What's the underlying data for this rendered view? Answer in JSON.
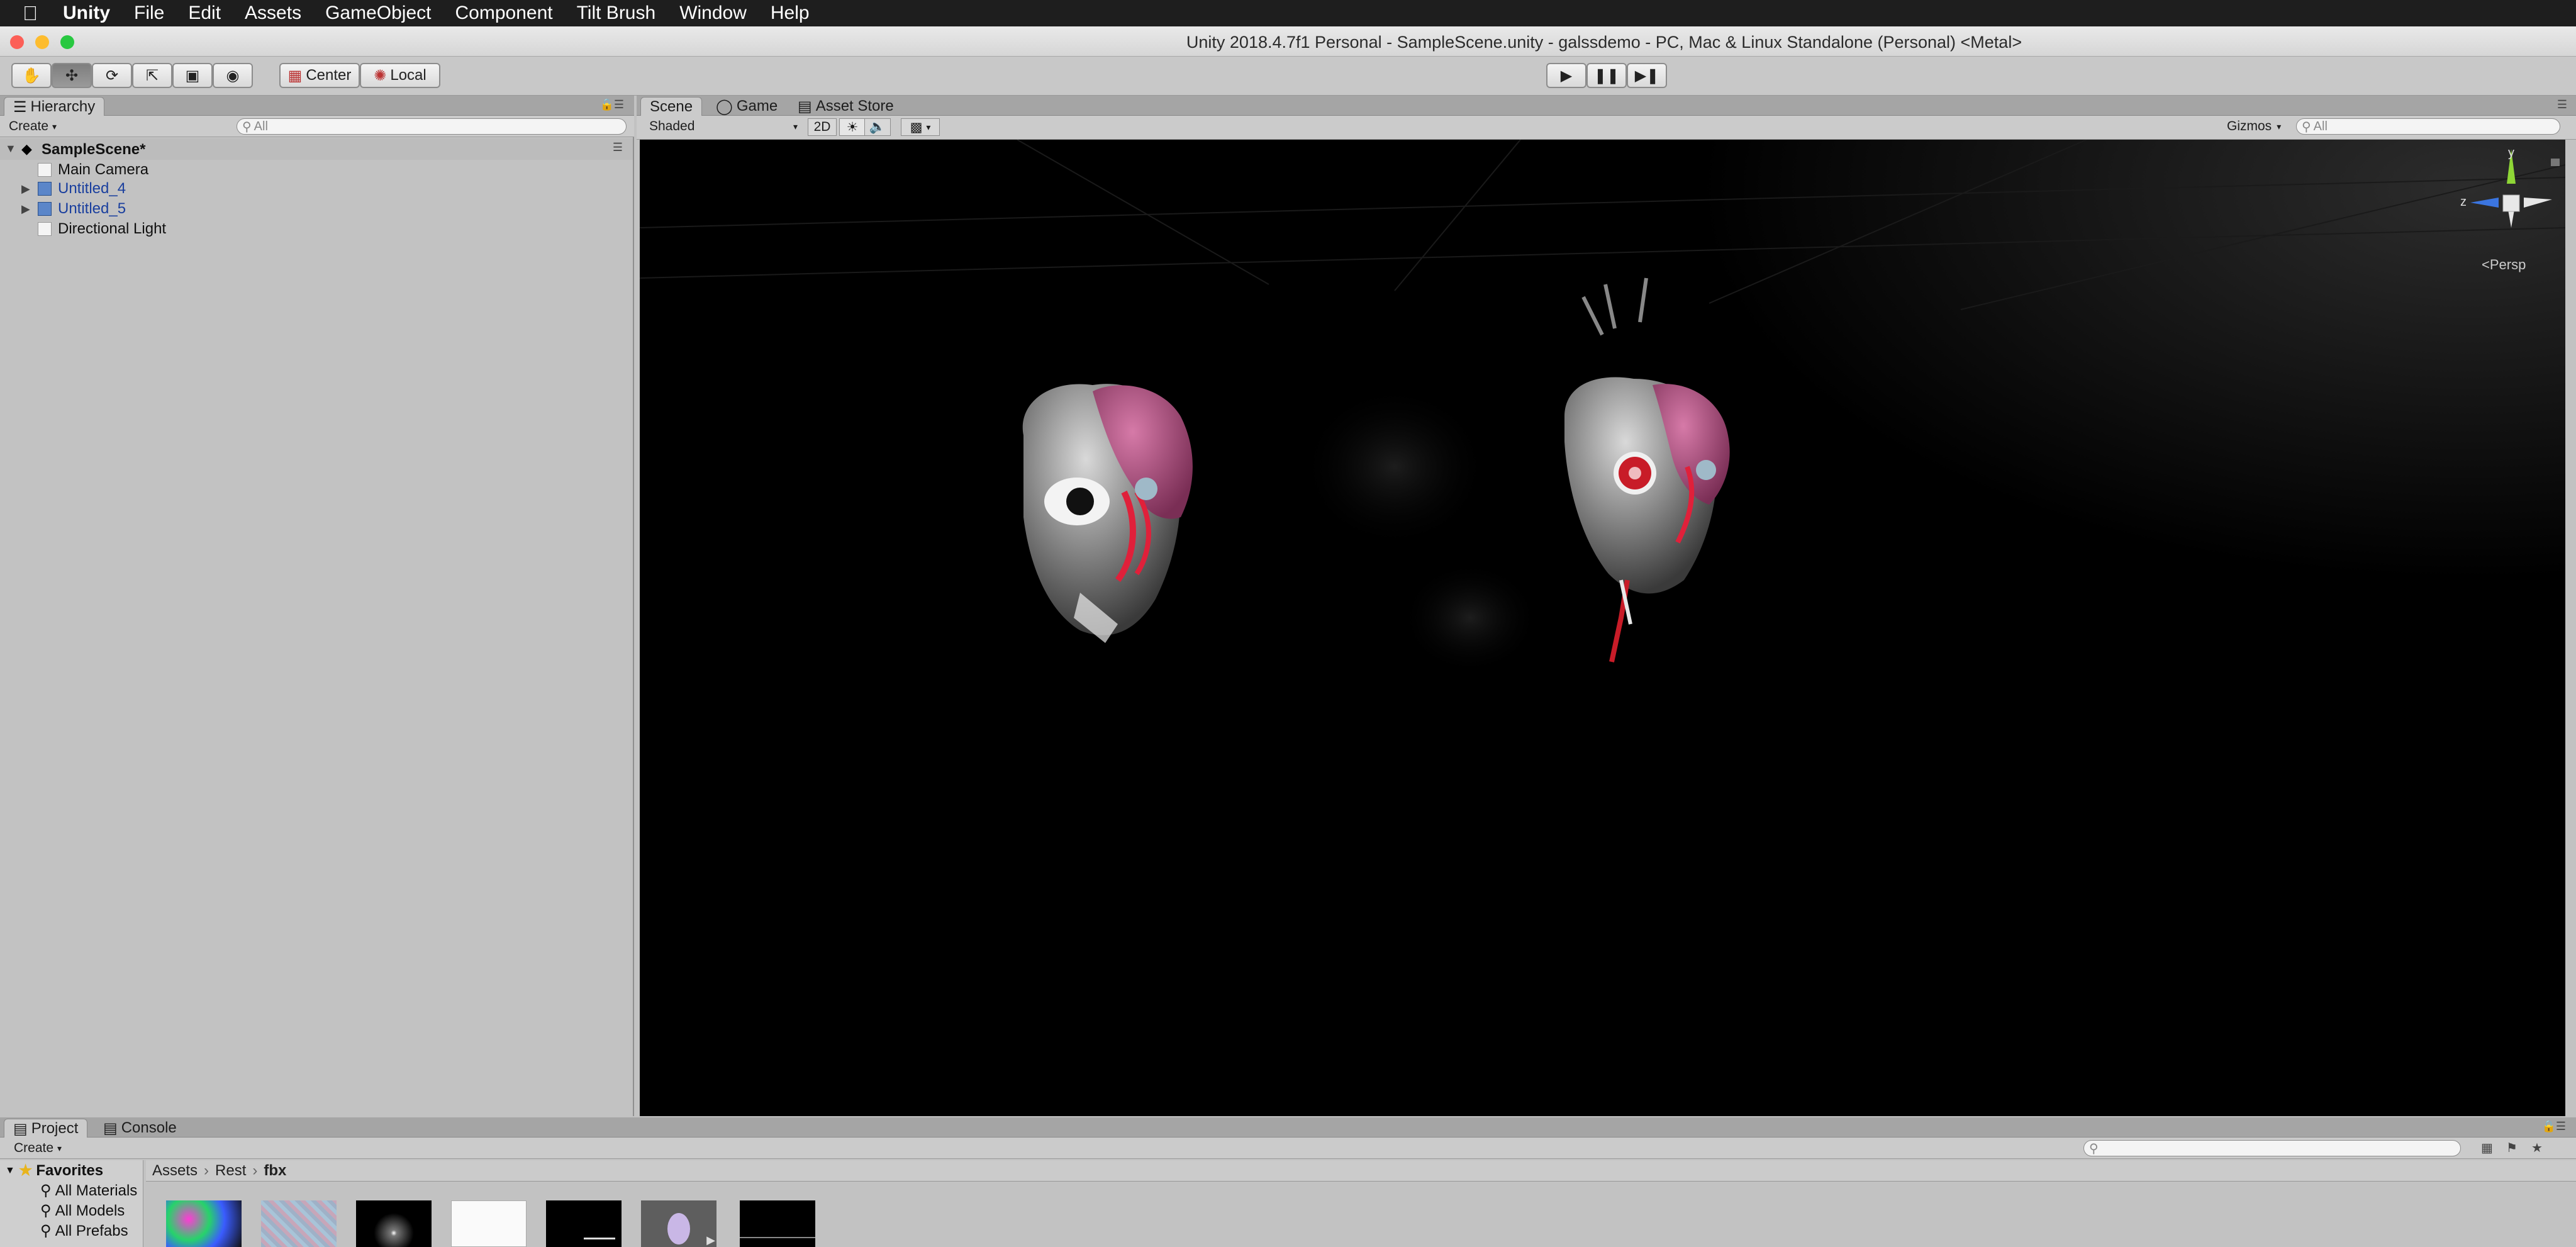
{
  "menubar": {
    "apple_icon": "apple-icon",
    "app_name": "Unity",
    "items": [
      "File",
      "Edit",
      "Assets",
      "GameObject",
      "Component",
      "Tilt Brush",
      "Window",
      "Help"
    ]
  },
  "window": {
    "title": "Unity 2018.4.7f1 Personal - SampleScene.unity - galssdemo - PC, Mac & Linux Standalone (Personal) <Metal>"
  },
  "toolbar": {
    "tools": [
      "hand-icon",
      "move-icon",
      "rotate-icon",
      "scale-icon",
      "rect-icon",
      "transform-icon"
    ],
    "pivot_label": "Center",
    "space_label": "Local",
    "play": [
      "play-icon",
      "pause-icon",
      "step-icon"
    ]
  },
  "hierarchy": {
    "tab_label": "Hierarchy",
    "create_label": "Create",
    "search_placeholder": "All",
    "scene_name": "SampleScene*",
    "items": [
      {
        "label": "Main Camera",
        "color": "#111111"
      },
      {
        "label": "Untitled_4",
        "color": "#1a3f9e"
      },
      {
        "label": "Untitled_5",
        "color": "#1a3f9e"
      },
      {
        "label": "Directional Light",
        "color": "#111111"
      }
    ]
  },
  "scene": {
    "tabs": [
      "Scene",
      "Game",
      "Asset Store"
    ],
    "shading_mode": "Shaded",
    "mode_2d": "2D",
    "gizmos_label": "Gizmos",
    "search_placeholder": "All",
    "gizmo_axes": {
      "y": "y",
      "z": "z"
    },
    "projection_label": "Persp"
  },
  "project": {
    "tabs": [
      "Project",
      "Console"
    ],
    "create_label": "Create",
    "favorites_label": "Favorites",
    "favorites": [
      "All Materials",
      "All Models",
      "All Prefabs"
    ],
    "breadcrumb": [
      "Assets",
      "Rest",
      "fbx"
    ]
  },
  "colors": {
    "menubar": "#1e1e1e",
    "panel": "#c2c2c2",
    "scene_bg": "#000000",
    "selection_blue": "#1a3f9e"
  }
}
